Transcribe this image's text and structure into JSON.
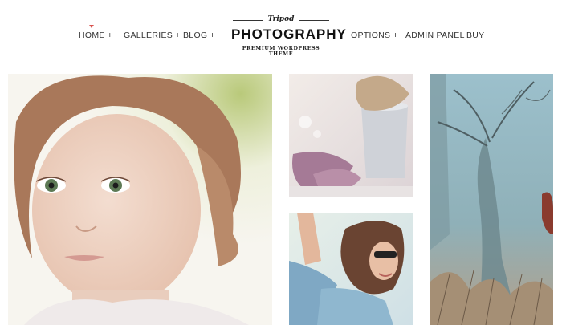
{
  "nav": {
    "left": [
      {
        "label": "HOME",
        "suffix": "+"
      },
      {
        "label": "GALLERIES",
        "suffix": "+"
      },
      {
        "label": "BLOG",
        "suffix": "+"
      }
    ],
    "right": [
      {
        "label": "OPTIONS",
        "suffix": "+"
      },
      {
        "label": "ADMIN PANEL",
        "suffix": ""
      },
      {
        "label": "BUY",
        "suffix": ""
      }
    ]
  },
  "logo": {
    "script": "Tripod",
    "title": "PHOTOGRAPHY",
    "subtitle": "PREMIUM WORDPRESS THEME"
  },
  "colors": {
    "accent": "#d9534f",
    "text": "#333333",
    "background": "#ffffff"
  },
  "gallery": {
    "photos": [
      {
        "name": "child-portrait-photo"
      },
      {
        "name": "autumn-leaves-cup-photo"
      },
      {
        "name": "woman-sunglasses-photo"
      },
      {
        "name": "forest-tree-photo"
      }
    ]
  }
}
